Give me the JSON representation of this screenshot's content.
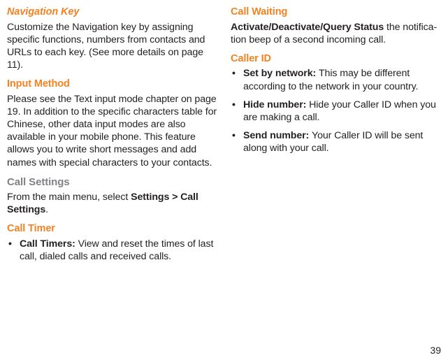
{
  "left": {
    "navkey_h": "Navigation Key",
    "navkey_p": "Customize the Navigation key by assigning specific functions, numbers from contacts and URLs to each key. (See more details on page 11).",
    "input_h": "Input Method",
    "input_p": "Please see the Text input mode chapter on page 19. In addition to the specific characters table for Chinese, other data input modes are also available in your mobile phone. This feature allows you to write short messages and add names with special characters to your contacts.",
    "callset_h": "Call Settings",
    "callset_p1_a": "From the main menu, select ",
    "callset_p1_b": "Settings > Call Settings",
    "callset_p1_c": ".",
    "calltimer_h": "Call Timer",
    "calltimer_li_b": "Call Timers: ",
    "calltimer_li_t": "View and reset the times of last call, dialed calls and received calls."
  },
  "right": {
    "callwait_h": "Call Waiting",
    "callwait_b": "Activate/Deactivate/Query Status",
    "callwait_t": " the notifica­tion beep of a second incoming call.",
    "callerid_h": "Caller ID",
    "li1_b": "Set by network: ",
    "li1_t": "This may be different according to the network in your country.",
    "li2_b": "Hide number: ",
    "li2_t": "Hide your Caller ID when you are making a call.",
    "li3_b": "Send number: ",
    "li3_t": "Your Caller ID will be sent along with your call."
  },
  "pagenum": "39"
}
